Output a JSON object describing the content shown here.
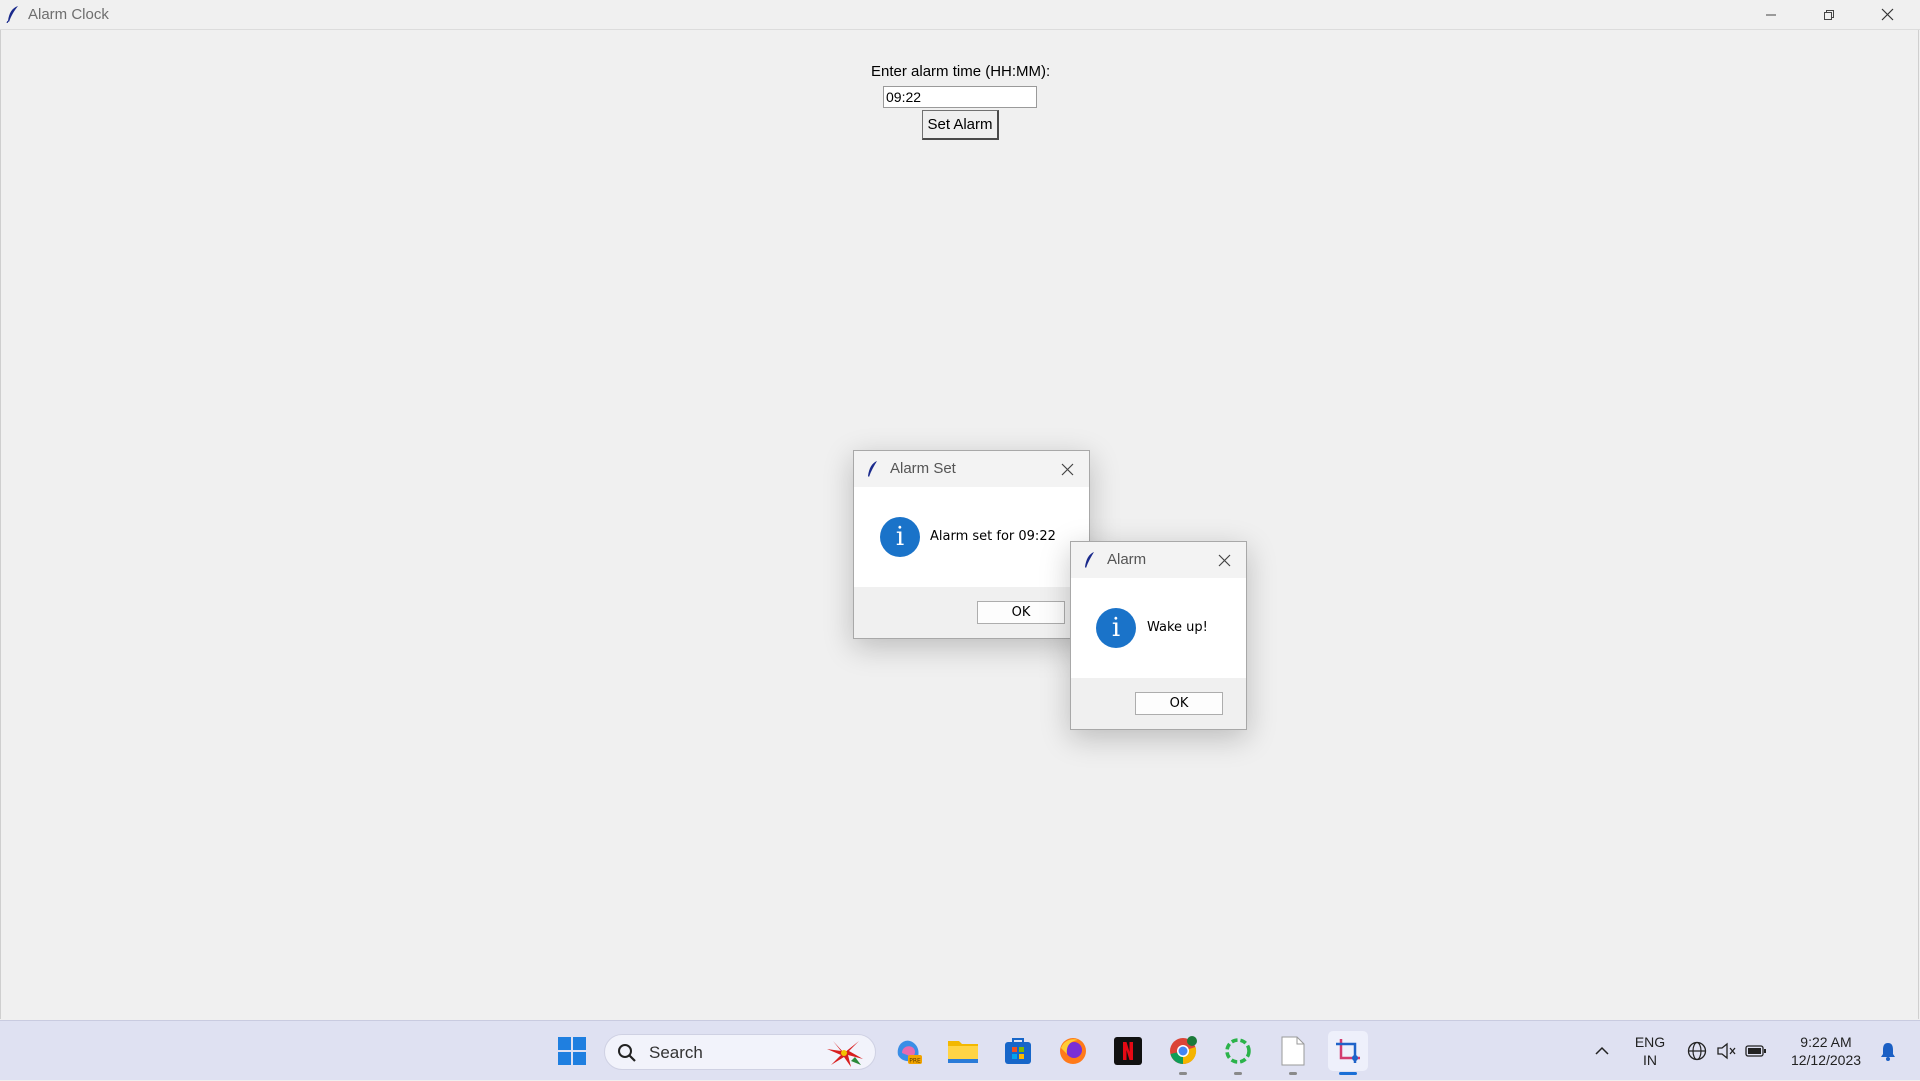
{
  "window": {
    "title": "Alarm Clock",
    "controls": {
      "minimize": "minimize",
      "maximize": "restore",
      "close": "close"
    }
  },
  "form": {
    "prompt_label": "Enter alarm time (HH:MM):",
    "time_value": "09:22",
    "set_button_label": "Set Alarm"
  },
  "dialogs": [
    {
      "title": "Alarm Set",
      "icon": "info-icon",
      "message": "Alarm set for 09:22",
      "ok_label": "OK"
    },
    {
      "title": "Alarm",
      "icon": "info-icon",
      "message": "Wake up!",
      "ok_label": "OK"
    }
  ],
  "taskbar": {
    "search_placeholder": "Search",
    "apps": [
      {
        "name": "start-icon",
        "running": false
      },
      {
        "name": "copilot-icon",
        "running": false
      },
      {
        "name": "file-explorer-icon",
        "running": false
      },
      {
        "name": "microsoft-store-icon",
        "running": false
      },
      {
        "name": "firefox-icon",
        "running": false
      },
      {
        "name": "netflix-icon",
        "running": false
      },
      {
        "name": "chrome-icon",
        "running": true
      },
      {
        "name": "circle-app-icon",
        "running": true
      },
      {
        "name": "file-icon",
        "running": true
      },
      {
        "name": "snipping-tool-icon",
        "running": true,
        "active": true
      }
    ],
    "tray": {
      "language_line1": "ENG",
      "language_line2": "IN",
      "time": "9:22 AM",
      "date": "12/12/2023"
    },
    "colors": {
      "accent": "#1b6fd6",
      "taskbar_bg": "#dfe1f2"
    }
  },
  "colors": {
    "info_icon": "#1a73c9",
    "window_bg": "#f0f0f0"
  }
}
